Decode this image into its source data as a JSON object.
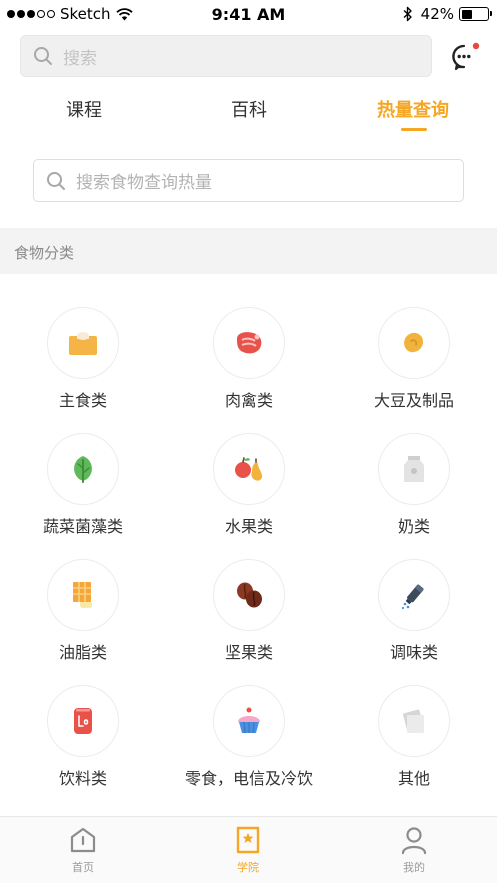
{
  "status_bar": {
    "carrier": "Sketch",
    "time": "9:41 AM",
    "battery": "42%",
    "battery_level": 0.42
  },
  "top_search": {
    "placeholder": "搜索"
  },
  "tabs": [
    {
      "label": "课程",
      "active": false
    },
    {
      "label": "百科",
      "active": false
    },
    {
      "label": "热量查询",
      "active": true
    }
  ],
  "food_search": {
    "placeholder": "搜索食物查询热量"
  },
  "section": {
    "title": "食物分类"
  },
  "categories": [
    {
      "label": "主食类",
      "icon": "bread-icon"
    },
    {
      "label": "肉禽类",
      "icon": "meat-icon"
    },
    {
      "label": "大豆及制品",
      "icon": "bean-icon"
    },
    {
      "label": "蔬菜菌藻类",
      "icon": "leaf-icon"
    },
    {
      "label": "水果类",
      "icon": "fruit-icon"
    },
    {
      "label": "奶类",
      "icon": "milk-carton-icon"
    },
    {
      "label": "油脂类",
      "icon": "butter-icon"
    },
    {
      "label": "坚果类",
      "icon": "nut-icon"
    },
    {
      "label": "调味类",
      "icon": "salt-shaker-icon"
    },
    {
      "label": "饮料类",
      "icon": "drink-can-icon"
    },
    {
      "label": "零食，电信及冷饮",
      "icon": "cupcake-icon"
    },
    {
      "label": "其他",
      "icon": "paper-stack-icon"
    }
  ],
  "bottom_nav": [
    {
      "label": "首页",
      "icon": "home-icon",
      "active": false
    },
    {
      "label": "学院",
      "icon": "academy-icon",
      "active": true
    },
    {
      "label": "我的",
      "icon": "profile-icon",
      "active": false
    }
  ],
  "colors": {
    "accent": "#f5a623",
    "notification_dot": "#e8473b"
  }
}
